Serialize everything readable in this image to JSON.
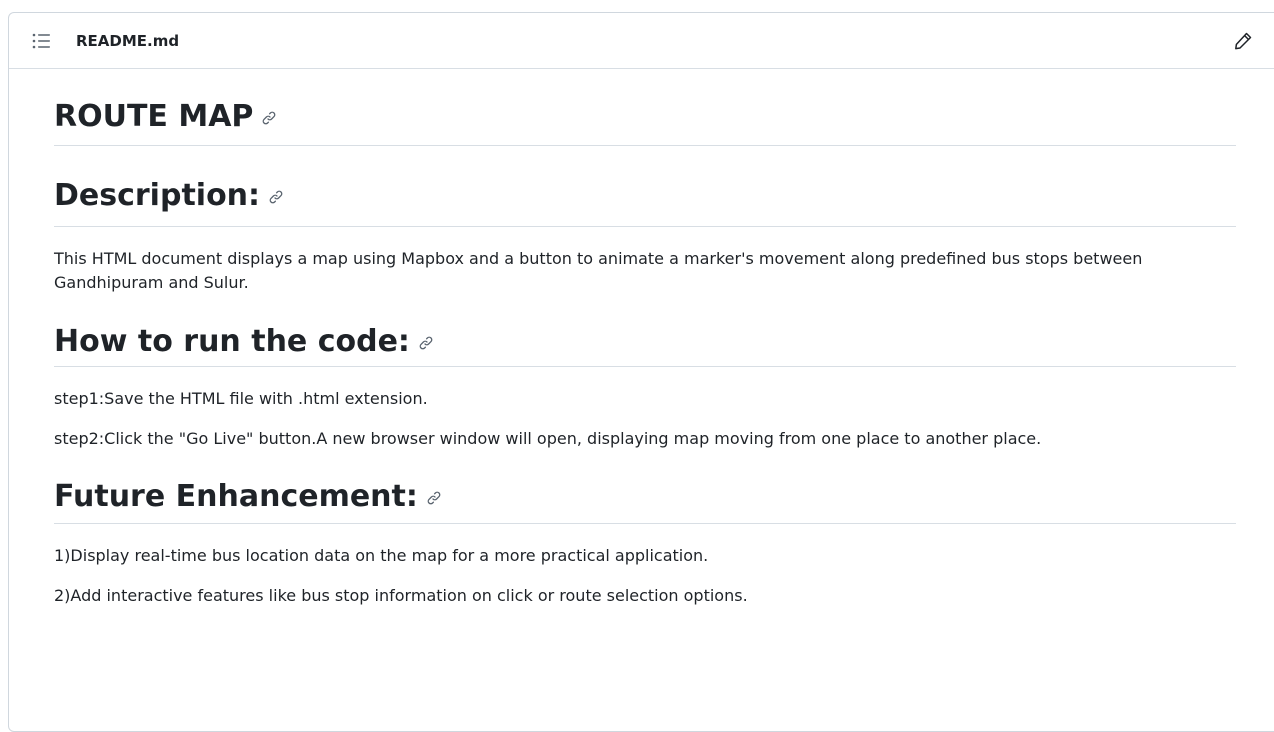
{
  "file": {
    "name": "README.md",
    "icons": {
      "outline": "list-icon",
      "edit": "pencil-icon",
      "anchor": "link-icon"
    }
  },
  "readme": {
    "title": "ROUTE MAP",
    "description": {
      "heading": "Description:",
      "text": "This HTML document displays a map using Mapbox and a button to animate a marker's movement along predefined bus stops between Gandhipuram and Sulur."
    },
    "how_to_run": {
      "heading": "How to run the code:",
      "steps": [
        "step1:Save the HTML file with .html extension.",
        "step2:Click the \"Go Live\" button.A new browser window will open, displaying map moving from one place to another place."
      ]
    },
    "future": {
      "heading": "Future Enhancement:",
      "items": [
        "1)Display real-time bus location data on the map for a more practical application.",
        "2)Add interactive features like bus stop information on click or route selection options."
      ]
    }
  },
  "colors": {
    "text": "#1f2328",
    "border": "#d0d7de",
    "icon": "#59636e"
  }
}
